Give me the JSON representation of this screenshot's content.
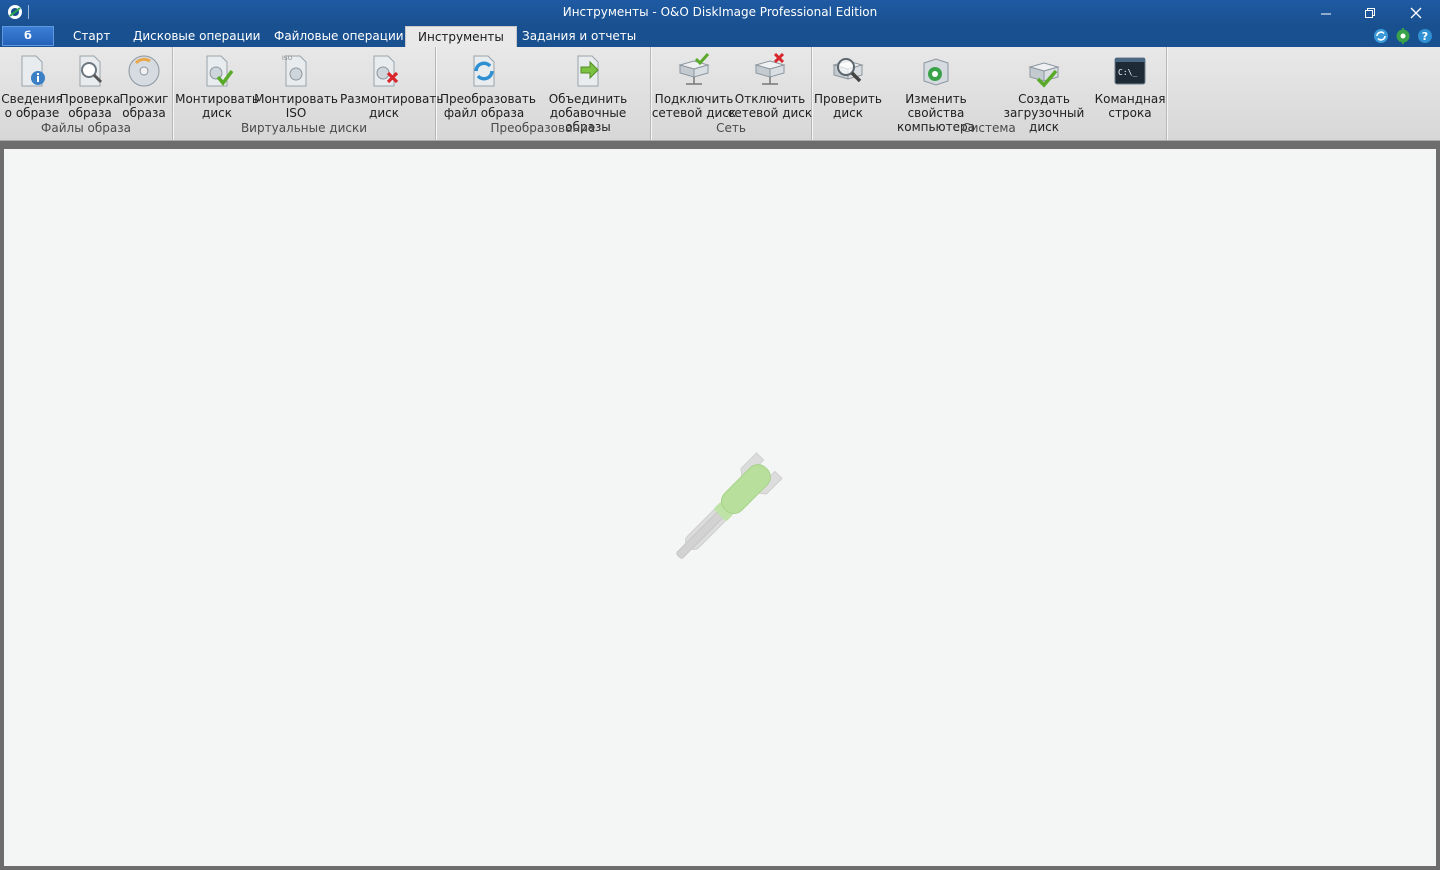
{
  "window": {
    "title": "Инструменты - O&O DiskImage Professional Edition"
  },
  "tabs": {
    "file_label": "б",
    "items": [
      "Старт",
      "Дисковые операции",
      "Файловые операции",
      "Инструменты",
      "Задания и отчеты"
    ],
    "active": "Инструменты"
  },
  "ribbon": {
    "groups": [
      {
        "label": "Файлы образа",
        "buttons": [
          {
            "line1": "Сведения",
            "line2": "о образе",
            "icon": "image-info-icon"
          },
          {
            "line1": "Проверка",
            "line2": "образа",
            "icon": "image-check-icon"
          },
          {
            "line1": "Прожиг",
            "line2": "образа",
            "icon": "burn-disc-icon"
          }
        ]
      },
      {
        "label": "Виртуальные диски",
        "buttons": [
          {
            "line1": "Монтировать",
            "line2": "диск",
            "icon": "mount-disk-icon"
          },
          {
            "line1": "Монтировать",
            "line2": "ISO",
            "icon": "mount-iso-icon"
          },
          {
            "line1": "Размонтировать",
            "line2": "диск",
            "icon": "unmount-disk-icon"
          }
        ]
      },
      {
        "label": "Преобразование",
        "buttons": [
          {
            "line1": "Преобразовать",
            "line2": "файл образа",
            "icon": "convert-image-icon"
          },
          {
            "line1": "Объединить",
            "line2": "добавочные образы",
            "icon": "merge-images-icon"
          }
        ]
      },
      {
        "label": "Сеть",
        "buttons": [
          {
            "line1": "Подключить",
            "line2": "сетевой диск",
            "icon": "connect-network-drive-icon"
          },
          {
            "line1": "Отключить",
            "line2": "сетевой диск",
            "icon": "disconnect-network-drive-icon"
          }
        ]
      },
      {
        "label": "Система",
        "buttons": [
          {
            "line1": "Проверить",
            "line2": "диск",
            "icon": "check-disk-icon"
          },
          {
            "line1": "Изменить свойства",
            "line2": "компьютера",
            "icon": "computer-properties-icon"
          },
          {
            "line1": "Создать",
            "line2": "загрузочный диск",
            "icon": "boot-disk-icon"
          },
          {
            "line1": "Командная",
            "line2": "строка",
            "icon": "command-prompt-icon"
          }
        ]
      }
    ]
  },
  "colors": {
    "titlebar": "#19508f",
    "ribbon_bg": "#e3e3e3",
    "content_bg": "#f4f5f5",
    "accent_green": "#7cc242",
    "accent_red": "#d8262c"
  },
  "icons": {
    "iso_badge": "ISO",
    "cmd_text": "C:\\_"
  }
}
